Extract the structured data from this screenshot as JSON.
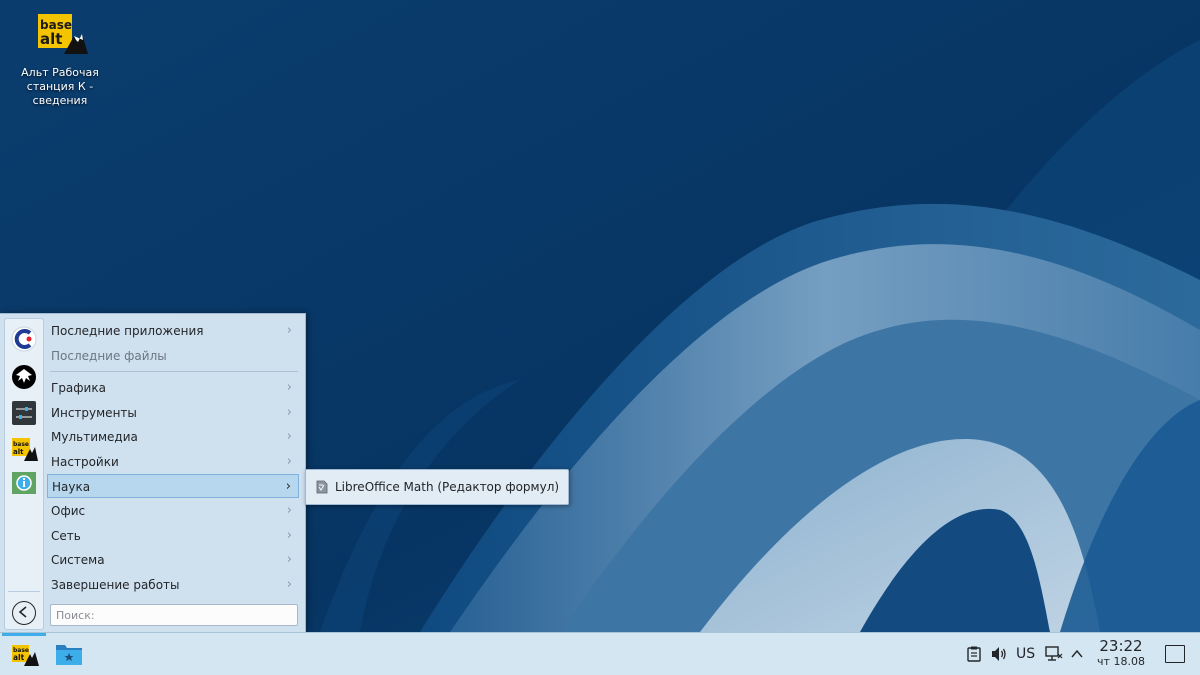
{
  "desktop": {
    "icon_label": "Альт Рабочая\nстанция К  -\nсведения",
    "logo_text_top": "base",
    "logo_text_bottom": "alt"
  },
  "menu": {
    "items": [
      {
        "label": "Последние приложения",
        "chevron": "›"
      },
      {
        "label": "Последние файлы"
      },
      {
        "label": "Графика",
        "chevron": "›"
      },
      {
        "label": "Инструменты",
        "chevron": "›"
      },
      {
        "label": "Мультимедиа",
        "chevron": "›"
      },
      {
        "label": "Настройки",
        "chevron": "›"
      },
      {
        "label": "Наука",
        "chevron": "›"
      },
      {
        "label": "Офис",
        "chevron": "›"
      },
      {
        "label": "Сеть",
        "chevron": "›"
      },
      {
        "label": "Система",
        "chevron": "›"
      },
      {
        "label": "Завершение работы",
        "chevron": "›"
      }
    ],
    "search_placeholder": "Поиск:"
  },
  "submenu": {
    "item_label": "LibreOffice Math (Редактор формул)"
  },
  "taskbar": {
    "keyboard_layout": "US",
    "time": "23:22",
    "date": "чт 18.08"
  },
  "icons": {
    "favorites": [
      "calligra-icon",
      "inkscape-icon",
      "settings-panel-icon",
      "basealt-icon",
      "info-center-icon"
    ],
    "tray": [
      "clipboard-icon",
      "volume-icon",
      "network-icon",
      "expand-tray-icon"
    ]
  },
  "colors": {
    "accent": "#3daee9",
    "desktop_bg": "#083a68",
    "menu_bg": "#cfe0ef",
    "taskbar_bg": "#d5e6f3",
    "brand_yellow": "#f5c400"
  }
}
